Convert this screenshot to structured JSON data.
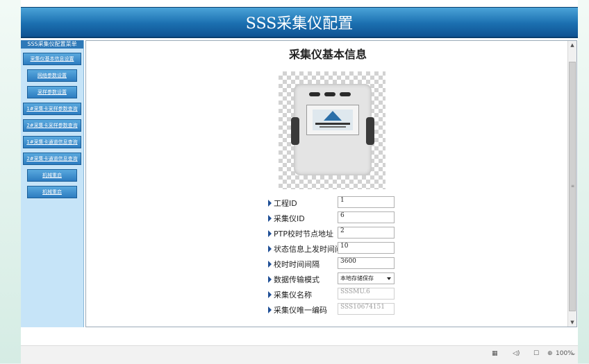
{
  "app": {
    "title": "SSS采集仪配置"
  },
  "sidebar": {
    "header": "SSS采集仪配置菜单",
    "items": [
      {
        "label": "采集仪基本信息设置"
      },
      {
        "label": "网络参数设置"
      },
      {
        "label": "采样参数设置"
      },
      {
        "label": "1#采集卡采样参数查询"
      },
      {
        "label": "2#采集卡采样参数查询"
      },
      {
        "label": "1#采集卡通道信息查询"
      },
      {
        "label": "2#采集卡通道信息查询"
      },
      {
        "label": "机械重启"
      },
      {
        "label": "机械重启"
      }
    ]
  },
  "panel": {
    "title": "采集仪基本信息",
    "fields": [
      {
        "label": "工程ID",
        "value": "1"
      },
      {
        "label": "采集仪ID",
        "value": "6"
      },
      {
        "label": "PTP校时节点地址",
        "value": "2"
      },
      {
        "label": "状态信息上发时间间隔",
        "value": "10"
      },
      {
        "label": "校时时间间隔",
        "value": "3600"
      },
      {
        "label": "数据传输模式",
        "value": "本地存储保存"
      },
      {
        "label": "采集仪名称",
        "value": "SSSMU.6"
      },
      {
        "label": "采集仪唯一编码",
        "value": "SSS10674151"
      }
    ]
  },
  "status_bar": {
    "zoom": "100%"
  }
}
